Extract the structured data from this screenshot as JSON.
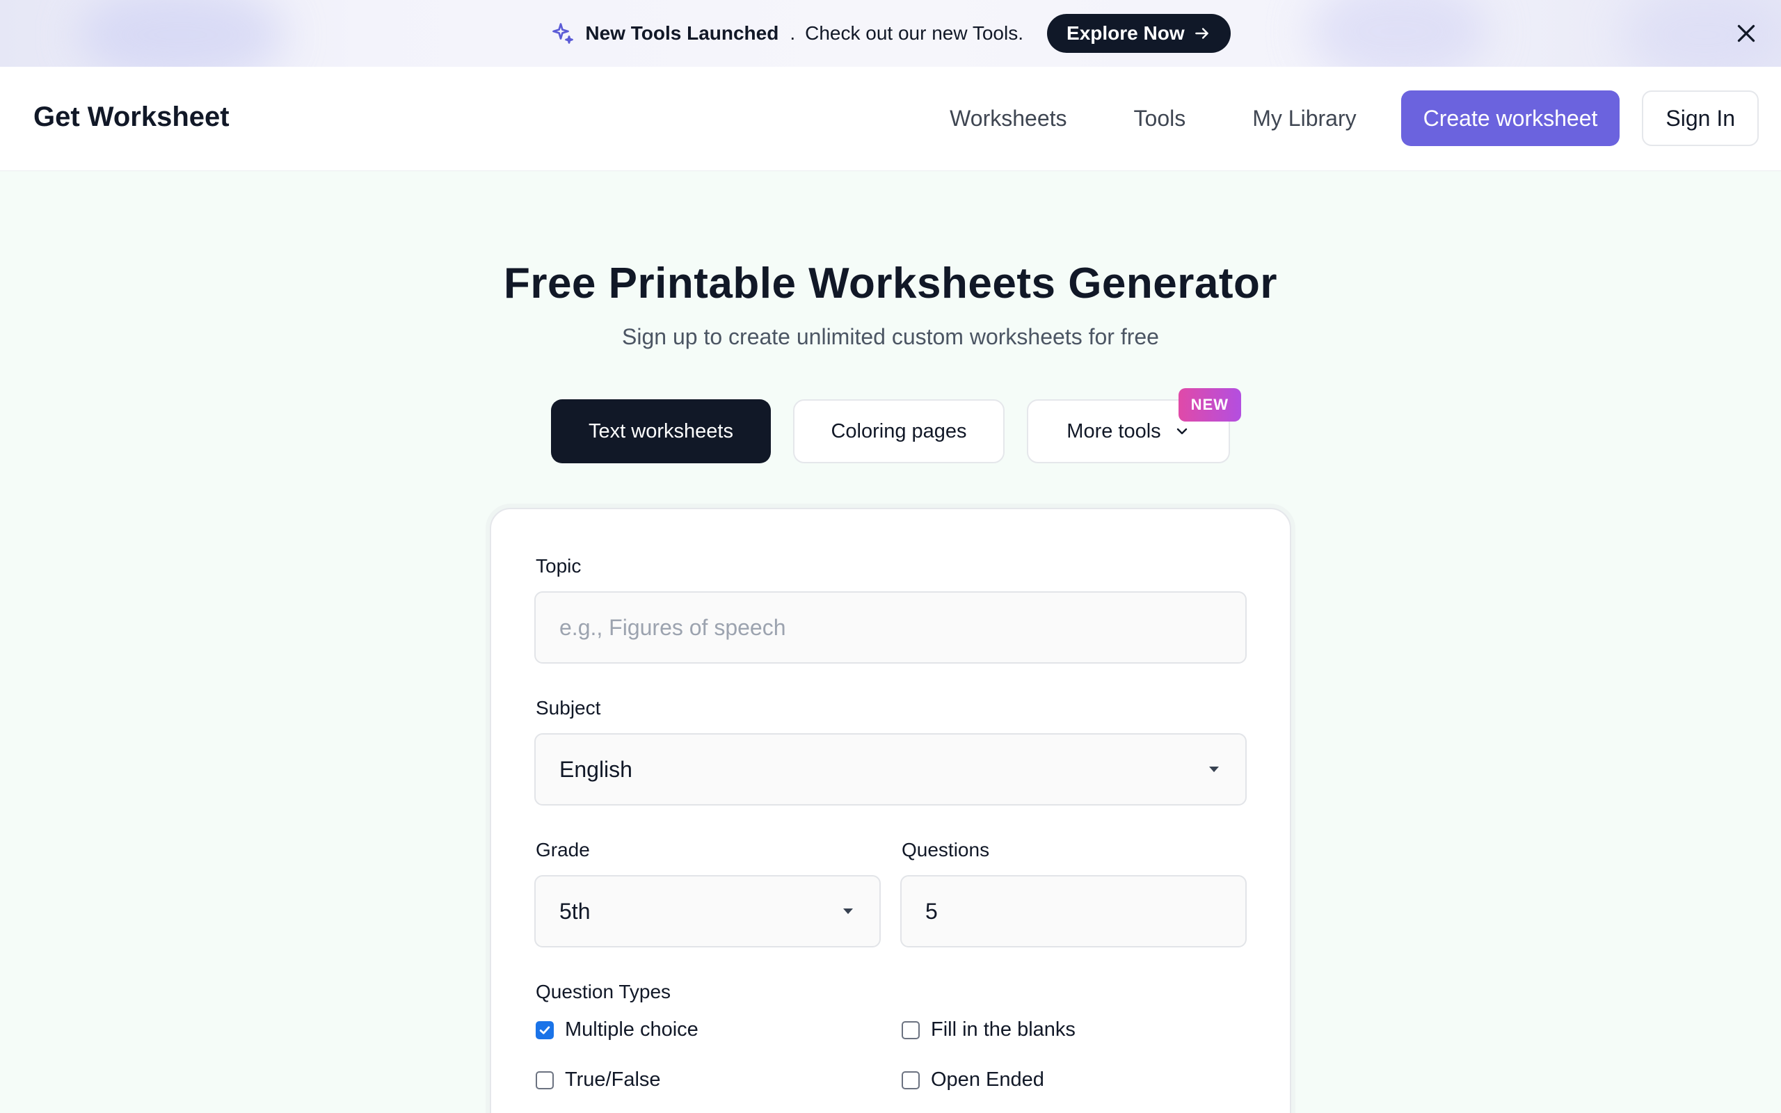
{
  "banner": {
    "title": "New Tools Launched",
    "separator": ".",
    "text": "Check out our new Tools.",
    "cta_label": "Explore Now"
  },
  "header": {
    "logo": "Get Worksheet",
    "nav": [
      "Worksheets",
      "Tools",
      "My Library"
    ],
    "create_label": "Create worksheet",
    "signin_label": "Sign In"
  },
  "hero": {
    "title": "Free Printable Worksheets Generator",
    "subtitle": "Sign up to create unlimited custom worksheets for free"
  },
  "tabs": {
    "text": "Text worksheets",
    "coloring": "Coloring pages",
    "more": "More tools",
    "new_badge": "NEW"
  },
  "form": {
    "topic_label": "Topic",
    "topic_placeholder": "e.g., Figures of speech",
    "subject_label": "Subject",
    "subject_value": "English",
    "grade_label": "Grade",
    "grade_value": "5th",
    "questions_label": "Questions",
    "questions_value": "5",
    "types_label": "Question Types",
    "types": {
      "multiple_choice": "Multiple choice",
      "fill_blanks": "Fill in the blanks",
      "true_false": "True/False",
      "open_ended": "Open Ended"
    }
  },
  "colors": {
    "accent": "#6b63de",
    "dark": "#111827",
    "page_bg": "#f5fcf8",
    "checkbox": "#1a73e8"
  },
  "icons": {
    "banner": "sparkle-icon",
    "cta": "arrow-right-icon",
    "close": "close-icon",
    "dropdown": "chevron-down-icon"
  }
}
